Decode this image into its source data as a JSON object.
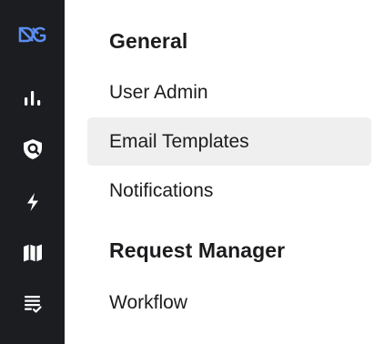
{
  "rail": {
    "icons": [
      "dg-logo-icon",
      "analytics-icon",
      "security-shield-icon",
      "lightning-icon",
      "map-icon",
      "checklist-icon"
    ],
    "logo_color": "#5b8def",
    "icon_color": "#ffffff",
    "background": "#1b1d20"
  },
  "sections": [
    {
      "title": "General",
      "items": [
        {
          "label": "User Admin",
          "active": false
        },
        {
          "label": "Email Templates",
          "active": true
        },
        {
          "label": "Notifications",
          "active": false
        }
      ]
    },
    {
      "title": "Request Manager",
      "items": [
        {
          "label": "Workflow",
          "active": false
        }
      ]
    }
  ],
  "active_item_background": "#efeff0"
}
